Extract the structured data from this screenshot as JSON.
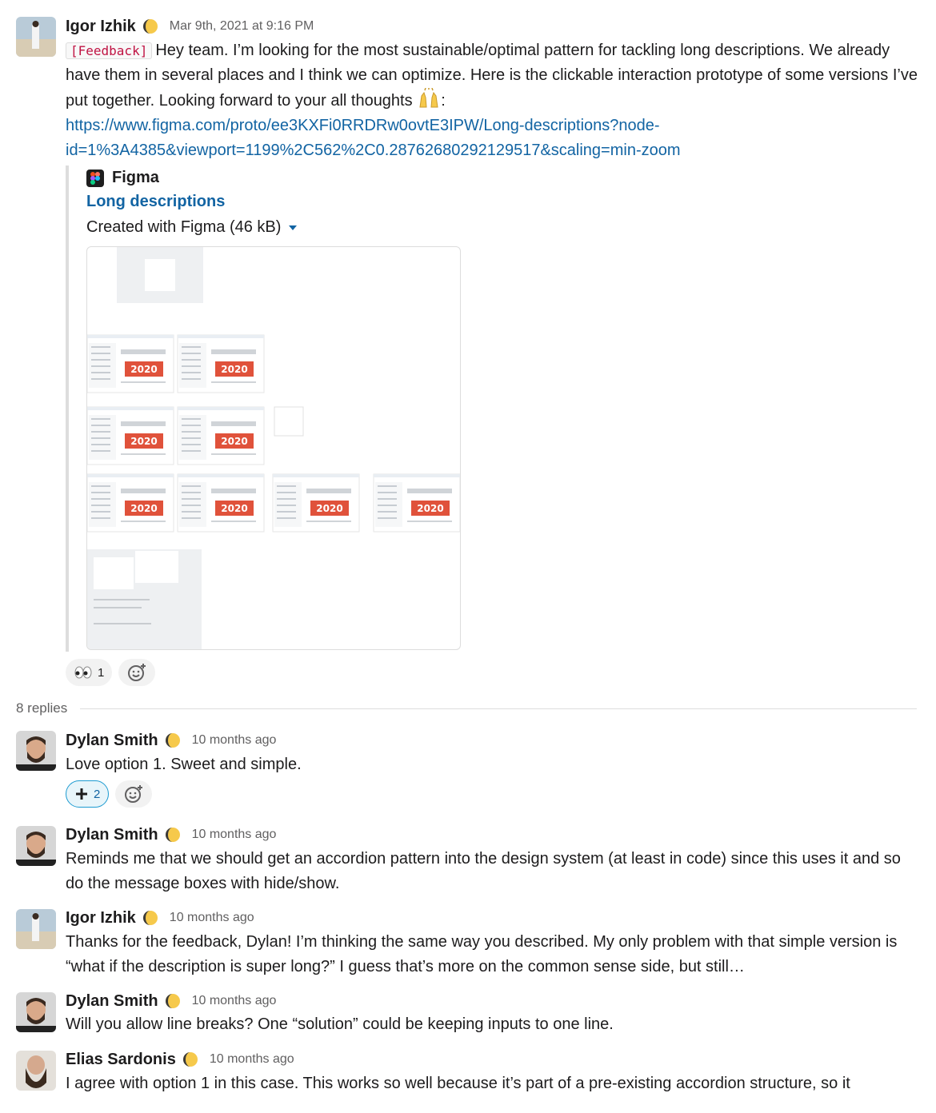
{
  "messages": [
    {
      "author": "Igor Izhik",
      "time": "Mar 9th, 2021 at 9:16 PM",
      "tag": "[Feedback]",
      "text": "Hey team. I’m looking for the most sustainable/optimal pattern for tackling long descriptions. We already have them in several places and I think we can optimize. Here is the clickable interaction prototype of some versions I’ve put together. Looking forward to your all thoughts",
      "text_after_emoji": ":",
      "link": "https://www.figma.com/proto/ee3KXFi0RRDRw0ovtE3IPW/Long-descriptions?node-id=1%3A4385&viewport=1199%2C562%2C0.28762680292129517&scaling=min-zoom",
      "reactions": [
        {
          "emoji": "eyes",
          "count": "1"
        }
      ]
    },
    {
      "author": "Dylan Smith",
      "time": "10 months ago",
      "text": "Love option 1. Sweet and simple.",
      "reactions": [
        {
          "emoji": "plus-one",
          "count": "2"
        }
      ]
    },
    {
      "author": "Dylan Smith",
      "time": "10 months ago",
      "text": "Reminds me that we should get an accordion pattern into the design system (at least in code) since this uses it and so do the message boxes with hide/show."
    },
    {
      "author": "Igor Izhik",
      "time": "10 months ago",
      "text": "Thanks for the feedback, Dylan! I’m thinking the same way you described. My only problem with that simple version is “what if the description is super long?” I guess that’s more on the common sense side, but still…"
    },
    {
      "author": "Dylan Smith",
      "time": "10 months ago",
      "text": "Will you allow line breaks? One “solution” could be keeping inputs to one line."
    },
    {
      "author": "Elias Sardonis",
      "time": "10 months ago",
      "text": "I agree with option 1 in this case.  This works so well because it’s part of a pre-existing accordion structure, so it"
    }
  ],
  "attachment": {
    "source": "Figma",
    "title": "Long descriptions",
    "meta": "Created with Figma (46 kB)",
    "thumb_label": "2020"
  },
  "thread": {
    "replies_label": "8 replies"
  },
  "colors": {
    "link": "#1264a3",
    "tag": "#c01343",
    "thumb_red": "#e0523b"
  }
}
